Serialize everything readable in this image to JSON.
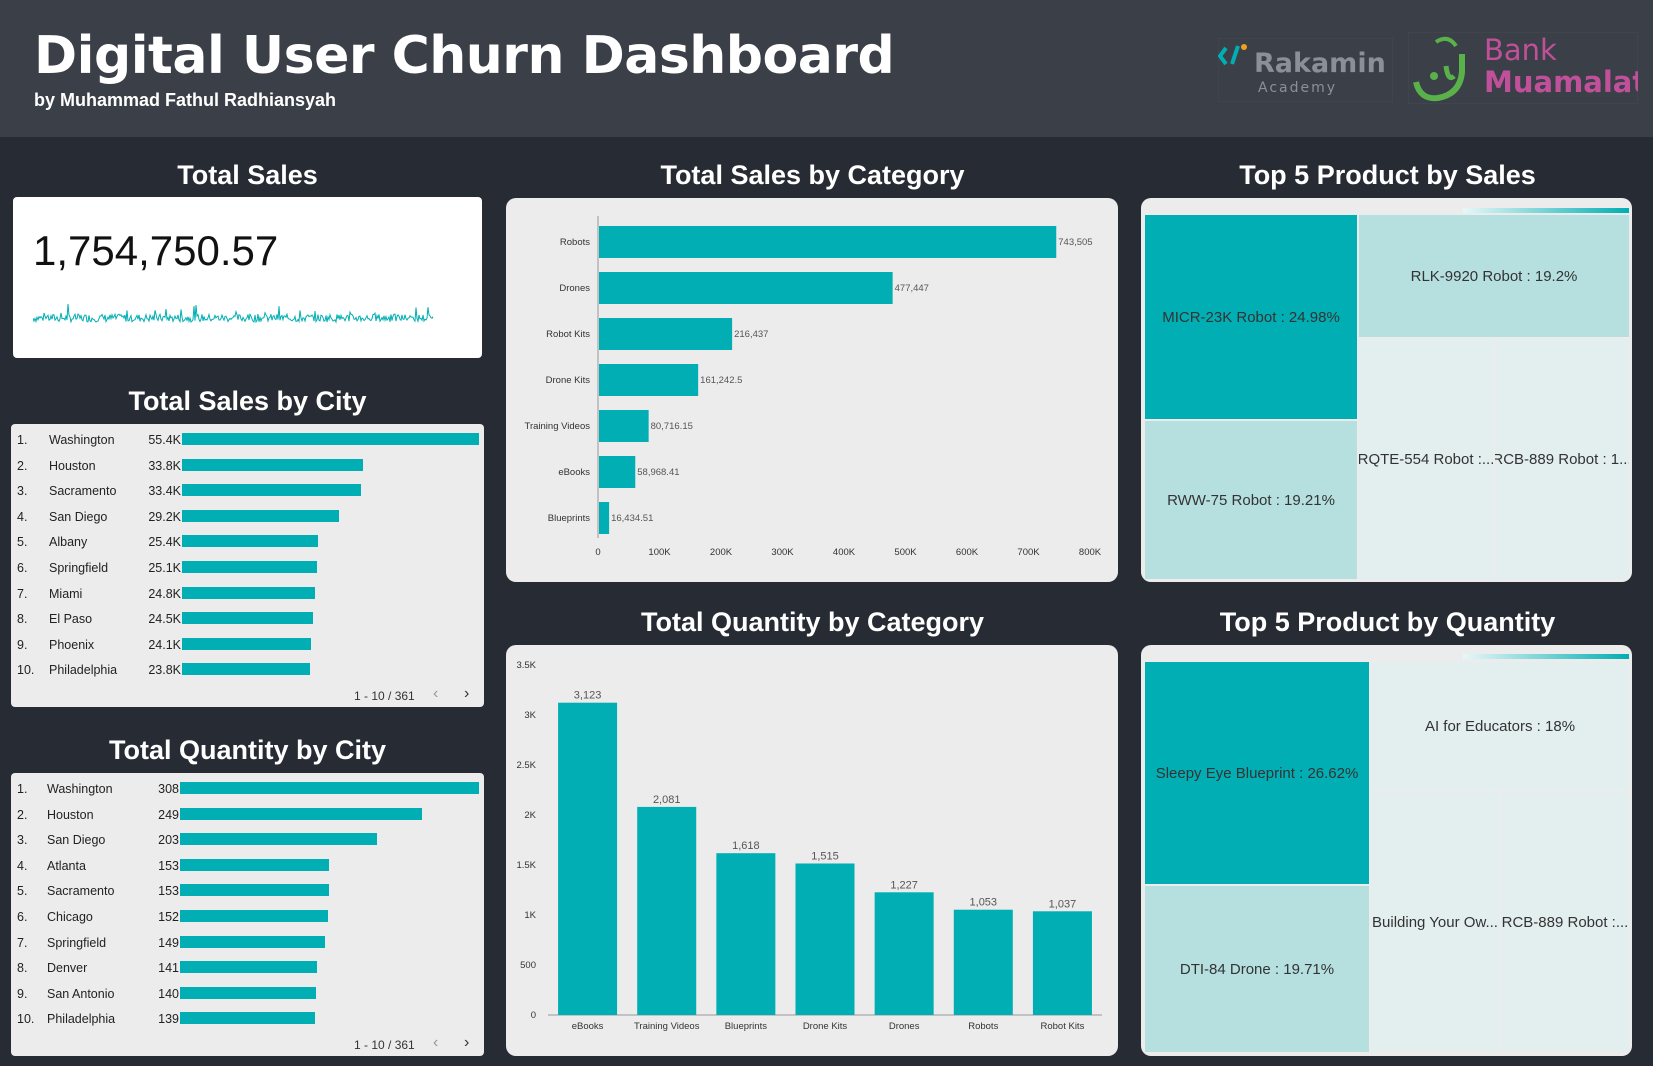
{
  "header": {
    "title": "Digital User Churn Dashboard",
    "subtitle": "by Muhammad Fathul Radhiansyah",
    "logo_rakamin_text": "Rakamin",
    "logo_rakamin_sub": "Academy",
    "logo_bank_line1": "Bank",
    "logo_bank_line2": "Muamalat"
  },
  "colors": {
    "accent": "#00aeb3",
    "light": "#b6e0e0",
    "header_bg": "#3b4048",
    "page_bg": "#272b33",
    "card_bg": "#ececec"
  },
  "total_sales": {
    "title": "Total Sales",
    "value": "1,754,750.57"
  },
  "sales_by_city": {
    "title": "Total Sales by City",
    "rows": [
      {
        "rank": "1.",
        "city": "Washington",
        "label": "55.4K",
        "value": 55.4
      },
      {
        "rank": "2.",
        "city": "Houston",
        "label": "33.8K",
        "value": 33.8
      },
      {
        "rank": "3.",
        "city": "Sacramento",
        "label": "33.4K",
        "value": 33.4
      },
      {
        "rank": "4.",
        "city": "San Diego",
        "label": "29.2K",
        "value": 29.2
      },
      {
        "rank": "5.",
        "city": "Albany",
        "label": "25.4K",
        "value": 25.4
      },
      {
        "rank": "6.",
        "city": "Springfield",
        "label": "25.1K",
        "value": 25.1
      },
      {
        "rank": "7.",
        "city": "Miami",
        "label": "24.8K",
        "value": 24.8
      },
      {
        "rank": "8.",
        "city": "El Paso",
        "label": "24.5K",
        "value": 24.5
      },
      {
        "rank": "9.",
        "city": "Phoenix",
        "label": "24.1K",
        "value": 24.1
      },
      {
        "rank": "10.",
        "city": "Philadelphia",
        "label": "23.8K",
        "value": 23.8
      }
    ],
    "pager": "1 - 10 / 361"
  },
  "quantity_by_city": {
    "title": "Total Quantity by City",
    "rows": [
      {
        "rank": "1.",
        "city": "Washington",
        "label": "308",
        "value": 308
      },
      {
        "rank": "2.",
        "city": "Houston",
        "label": "249",
        "value": 249
      },
      {
        "rank": "3.",
        "city": "San Diego",
        "label": "203",
        "value": 203
      },
      {
        "rank": "4.",
        "city": "Atlanta",
        "label": "153",
        "value": 153
      },
      {
        "rank": "5.",
        "city": "Sacramento",
        "label": "153",
        "value": 153
      },
      {
        "rank": "6.",
        "city": "Chicago",
        "label": "152",
        "value": 152
      },
      {
        "rank": "7.",
        "city": "Springfield",
        "label": "149",
        "value": 149
      },
      {
        "rank": "8.",
        "city": "Denver",
        "label": "141",
        "value": 141
      },
      {
        "rank": "9.",
        "city": "San Antonio",
        "label": "140",
        "value": 140
      },
      {
        "rank": "10.",
        "city": "Philadelphia",
        "label": "139",
        "value": 139
      }
    ],
    "pager": "1 - 10 / 361"
  },
  "top5_sales": {
    "title": "Top 5 Product by Sales",
    "items": [
      {
        "label": "MICR-23K Robot : 24.98%"
      },
      {
        "label": "RLK-9920 Robot : 19.2%"
      },
      {
        "label": "RWW-75 Robot : 19.21%"
      },
      {
        "label": "RQTE-554 Robot :..."
      },
      {
        "label": "RCB-889 Robot : 1..."
      }
    ]
  },
  "top5_quantity": {
    "title": "Top 5 Product by Quantity",
    "items": [
      {
        "label": "Sleepy Eye Blueprint : 26.62%"
      },
      {
        "label": "AI for Educators : 18%"
      },
      {
        "label": "DTI-84 Drone : 19.71%"
      },
      {
        "label": "Building Your Ow..."
      },
      {
        "label": "RCB-889 Robot :..."
      }
    ]
  },
  "chart_data": [
    {
      "type": "bar",
      "orientation": "horizontal",
      "title": "Total Sales by Category",
      "categories": [
        "Robots",
        "Drones",
        "Robot Kits",
        "Drone Kits",
        "Training Videos",
        "eBooks",
        "Blueprints"
      ],
      "values": [
        743505,
        477447,
        216437,
        161242.5,
        80716.15,
        58968.41,
        16434.51
      ],
      "value_labels": [
        "743,505",
        "477,447",
        "216,437",
        "161,242.5",
        "80,716.15",
        "58,968.41",
        "16,434.51"
      ],
      "xlim": [
        0,
        800000
      ],
      "ticks": [
        "0",
        "100K",
        "200K",
        "300K",
        "400K",
        "500K",
        "600K",
        "700K",
        "800K"
      ]
    },
    {
      "type": "bar",
      "orientation": "vertical",
      "title": "Total Quantity by Category",
      "categories": [
        "eBooks",
        "Training Videos",
        "Blueprints",
        "Drone Kits",
        "Drones",
        "Robots",
        "Robot Kits"
      ],
      "values": [
        3123,
        2081,
        1618,
        1515,
        1227,
        1053,
        1037
      ],
      "value_labels": [
        "3,123",
        "2,081",
        "1,618",
        "1,515",
        "1,227",
        "1,053",
        "1,037"
      ],
      "ylim": [
        0,
        3500
      ],
      "ticks": [
        "0",
        "500",
        "1K",
        "1.5K",
        "2K",
        "2.5K",
        "3K",
        "3.5K"
      ]
    }
  ]
}
